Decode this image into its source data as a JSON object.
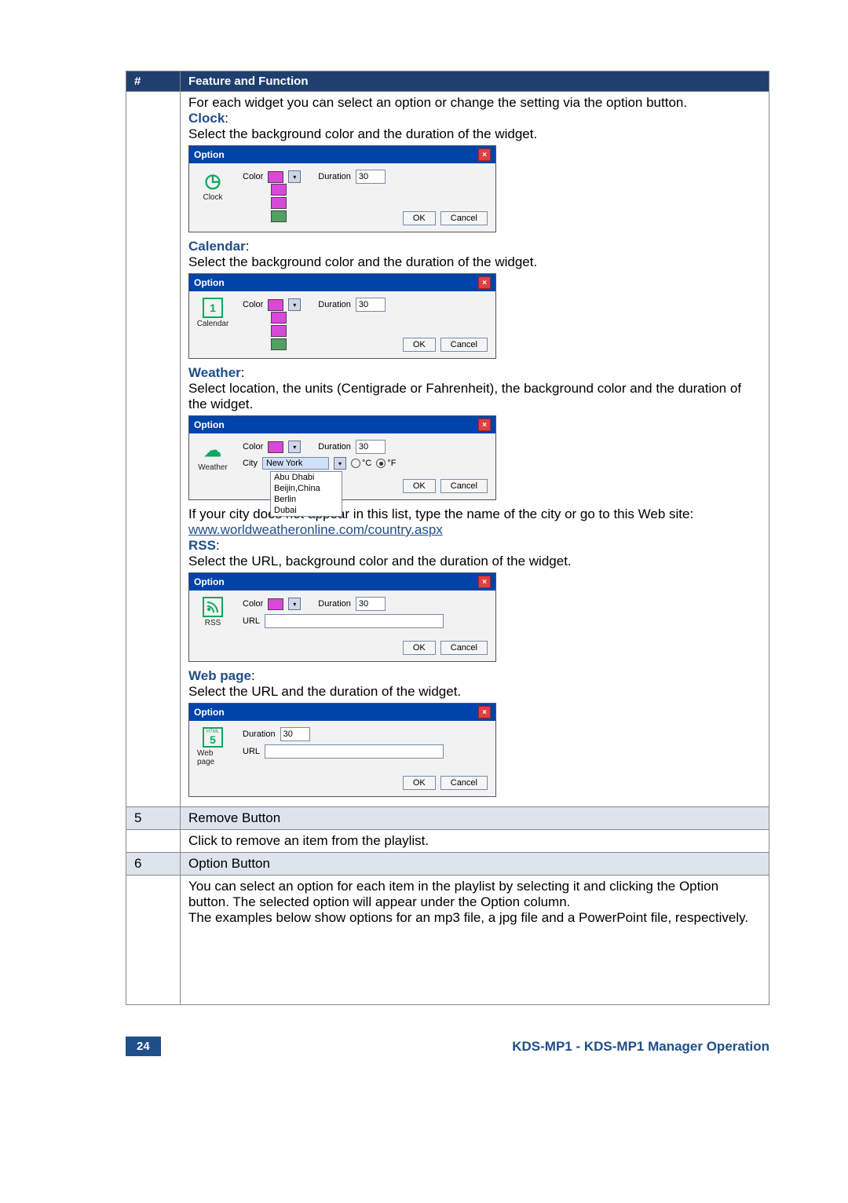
{
  "table": {
    "header": {
      "numcol": "#",
      "featcol": "Feature and Function"
    },
    "row4": {
      "intro": "For each widget you can select an option or change the setting via the option button.",
      "clock": {
        "title": "Clock",
        "desc": "Select the background color and the duration of the widget.",
        "dialog": {
          "title": "Option",
          "icon_label": "Clock",
          "color_label": "Color",
          "duration_label": "Duration",
          "duration_value": "30",
          "ok": "OK",
          "cancel": "Cancel"
        }
      },
      "calendar": {
        "title": "Calendar",
        "desc": "Select the background color and the duration of the widget.",
        "dialog": {
          "title": "Option",
          "icon_label": "Calendar",
          "icon_num": "1",
          "color_label": "Color",
          "duration_label": "Duration",
          "duration_value": "30",
          "ok": "OK",
          "cancel": "Cancel"
        }
      },
      "weather": {
        "title": "Weather",
        "desc": "Select location, the units (Centigrade or Fahrenheit), the background color and the duration of the widget.",
        "dialog": {
          "title": "Option",
          "icon_label": "Weather",
          "color_label": "Color",
          "duration_label": "Duration",
          "duration_value": "30",
          "city_label": "City",
          "city_value": "New York",
          "unit_c": "°C",
          "unit_f": "°F",
          "city_options": [
            "Abu Dhabi",
            "Beijin,China",
            "Berlin",
            "Dubai"
          ],
          "ok": "OK",
          "cancel": "Cancel"
        },
        "post_text": "If your city does not appear in this list, type the name of the city or go to this Web site:",
        "link": "www.worldweatheronline.com/country.aspx"
      },
      "rss": {
        "title": "RSS",
        "desc": "Select the URL, background color and the duration of the widget.",
        "dialog": {
          "title": "Option",
          "icon_label": "RSS",
          "color_label": "Color",
          "duration_label": "Duration",
          "duration_value": "30",
          "url_label": "URL",
          "ok": "OK",
          "cancel": "Cancel"
        }
      },
      "webpage": {
        "title": "Web page",
        "desc": "Select the URL and the duration of the widget.",
        "dialog": {
          "title": "Option",
          "icon_label": "Web page",
          "icon_top": "HTML",
          "icon_num": "5",
          "duration_label": "Duration",
          "duration_value": "30",
          "url_label": "URL",
          "ok": "OK",
          "cancel": "Cancel"
        }
      }
    },
    "row5": {
      "num": "5",
      "title": "Remove Button",
      "desc": "Click to remove an item from the playlist."
    },
    "row6": {
      "num": "6",
      "title": "Option Button",
      "desc": "You can select an option for each item in the playlist by selecting it and clicking the Option button. The selected option will appear under the Option column.\nThe examples below show options for an mp3 file, a jpg file and a PowerPoint file, respectively."
    }
  },
  "footer": {
    "page": "24",
    "text": "KDS-MP1 - KDS-MP1 Manager Operation"
  }
}
